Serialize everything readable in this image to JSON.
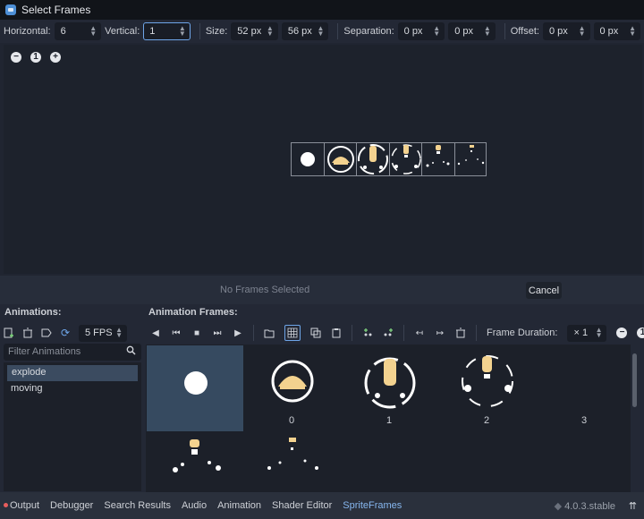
{
  "dialog": {
    "title": "Select Frames"
  },
  "toolbar": {
    "horizontal_label": "Horizontal:",
    "horizontal_value": "6",
    "vertical_label": "Vertical:",
    "vertical_value": "1",
    "size_label": "Size:",
    "size_w": "52 px",
    "size_h": "56 px",
    "separation_label": "Separation:",
    "sep_x": "0 px",
    "sep_y": "0 px",
    "offset_label": "Offset:",
    "off_x": "0 px",
    "off_y": "0 px"
  },
  "zoom": {
    "out": "−",
    "reset": "1",
    "in": "+"
  },
  "status": {
    "text": "No Frames Selected",
    "cancel": "Cancel"
  },
  "animations": {
    "header": "Animations:",
    "fps": "5 FPS",
    "filter_placeholder": "Filter Animations",
    "items": [
      "explode",
      "moving"
    ]
  },
  "frames": {
    "header": "Animation Frames:",
    "duration_label": "Frame Duration:",
    "duration_value": "× 1",
    "labels": [
      "0",
      "1",
      "2",
      "3"
    ]
  },
  "bottom": {
    "tabs": [
      "Output",
      "Debugger",
      "Search Results",
      "Audio",
      "Animation",
      "Shader Editor",
      "SpriteFrames"
    ],
    "version": "4.0.3.stable"
  },
  "colors": {
    "accent": "#6ea5e8",
    "sprite": "#f3d28f",
    "selected": "#364a60"
  }
}
